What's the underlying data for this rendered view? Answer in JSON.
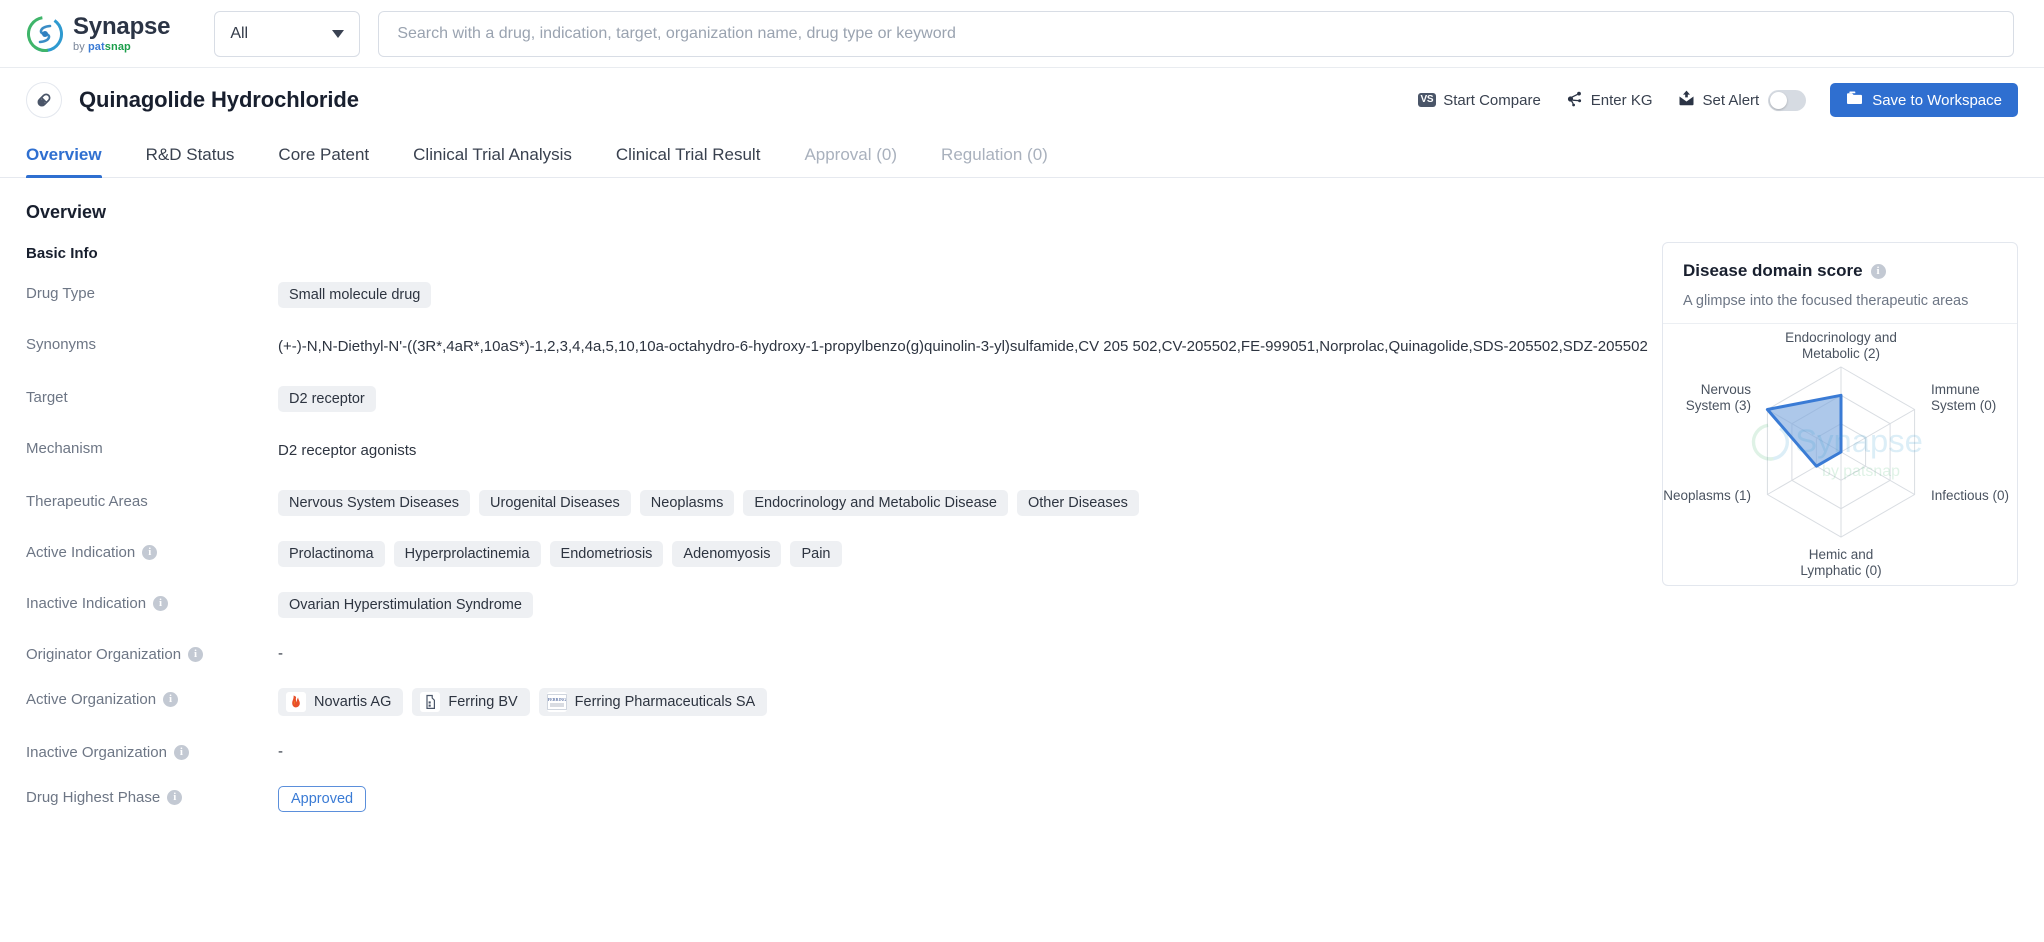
{
  "topbar": {
    "brand": {
      "name": "Synapse",
      "by": "by ",
      "pat": "pat",
      "snap": "snap"
    },
    "scope": {
      "value": "All",
      "icon": "chevron-down-icon"
    },
    "search": {
      "value": "",
      "placeholder": "Search with a drug, indication, target, organization name, drug type or keyword"
    }
  },
  "drug_header": {
    "icon": "capsule-icon",
    "title": "Quinagolide Hydrochloride",
    "actions": {
      "start_compare": "Start Compare",
      "start_compare_chip": "VS",
      "enter_kg": "Enter KG",
      "set_alert": "Set Alert",
      "set_alert_state": "off",
      "save_to_workspace": "Save to Workspace"
    }
  },
  "tabs": [
    {
      "label": "Overview",
      "state": "active"
    },
    {
      "label": "R&D Status",
      "state": "normal"
    },
    {
      "label": "Core Patent",
      "state": "normal"
    },
    {
      "label": "Clinical Trial Analysis",
      "state": "normal"
    },
    {
      "label": "Clinical Trial Result",
      "state": "normal"
    },
    {
      "label": "Approval (0)",
      "state": "disabled"
    },
    {
      "label": "Regulation (0)",
      "state": "disabled"
    }
  ],
  "overview": {
    "heading": "Overview",
    "basic_info_heading": "Basic Info",
    "labels": {
      "drug_type": "Drug Type",
      "synonyms": "Synonyms",
      "target": "Target",
      "mechanism": "Mechanism",
      "therapeutic_areas": "Therapeutic Areas",
      "active_indication": "Active Indication",
      "inactive_indication": "Inactive Indication",
      "originator_organization": "Originator Organization",
      "active_organization": "Active Organization",
      "inactive_organization": "Inactive Organization",
      "drug_highest_phase": "Drug Highest Phase"
    },
    "drug_type": [
      "Small molecule drug"
    ],
    "synonyms": "(+-)-N,N-Diethyl-N'-((3R*,4aR*,10aS*)-1,2,3,4,4a,5,10,10a-octahydro-6-hydroxy-1-propylbenzo(g)quinolin-3-yl)sulfamide,CV 205 502,CV-205502,FE-999051,Norprolac,Quinagolide,SDS-205502,SDZ-205502",
    "target": [
      "D2 receptor"
    ],
    "mechanism": "D2 receptor agonists",
    "therapeutic_areas": [
      "Nervous System Diseases",
      "Urogenital Diseases",
      "Neoplasms",
      "Endocrinology and Metabolic Disease",
      "Other Diseases"
    ],
    "active_indication": [
      "Prolactinoma",
      "Hyperprolactinemia",
      "Endometriosis",
      "Adenomyosis",
      "Pain"
    ],
    "inactive_indication": [
      "Ovarian Hyperstimulation Syndrome"
    ],
    "originator_organization": "-",
    "active_organization": [
      {
        "name": "Novartis AG",
        "icon": "novartis-flame-logo"
      },
      {
        "name": "Ferring BV",
        "icon": "building-icon"
      },
      {
        "name": "Ferring Pharmaceuticals SA",
        "icon": "ferring-logo"
      }
    ],
    "inactive_organization": "-",
    "drug_highest_phase": "Approved"
  },
  "score_card": {
    "title": "Disease domain score",
    "info_icon": "info-icon",
    "subtitle": "A glimpse into the focused therapeutic areas",
    "watermark": {
      "line1": "Synapse",
      "line2": "by patsnap"
    }
  },
  "chart_data": {
    "type": "radar",
    "title": "Disease domain score",
    "subtitle": "A glimpse into the focused therapeutic areas",
    "categories": [
      "Endocrinology and Metabolic",
      "Immune System",
      "Infectious",
      "Hemic and Lymphatic",
      "Neoplasms",
      "Nervous System"
    ],
    "tick_labels": [
      "Endocrinology and\nMetabolic (2)",
      "Immune\nSystem (0)",
      "Infectious (0)",
      "Hemic and\nLymphatic (0)",
      "Neoplasms (1)",
      "Nervous\nSystem (3)"
    ],
    "values": [
      2,
      0,
      0,
      0,
      1,
      3
    ],
    "max": 3,
    "rings": 3,
    "grid": true,
    "legend": "none",
    "fill_color": "#7ba7dd",
    "line_color": "#3a7bd5",
    "grid_color": "#d9dde2"
  },
  "colors": {
    "accent": "#2f6fd0",
    "tag_bg": "#eef0f3",
    "label_text": "#6d7685",
    "title_text": "#181f2e",
    "border": "#e3e7ee",
    "disabled_tab": "#a9b1bd"
  }
}
